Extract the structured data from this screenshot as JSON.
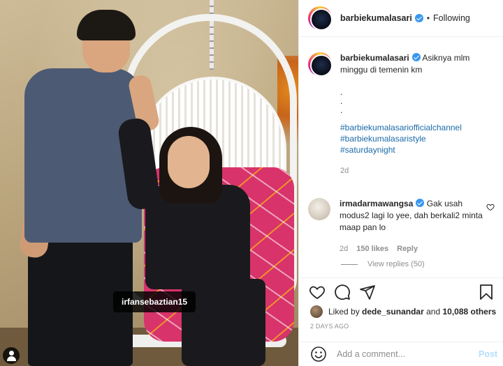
{
  "post": {
    "username": "barbiekumalasari",
    "follow_status": "Following",
    "separator": "•",
    "photo_tag": "irfansebaztian15"
  },
  "caption": {
    "username": "barbiekumalasari",
    "text": "Asiknya mlm minggu di temenin km",
    "dots": [
      ".",
      ".",
      "."
    ],
    "hashtags": [
      "#barbiekumalasariofficialchannel",
      "#barbiekumalasaristyle",
      "#saturdaynight"
    ],
    "time": "2d"
  },
  "comment": {
    "username": "irmadarmawangsa",
    "text": "Gak usah modus2 lagi lo yee, dah berkali2 minta maap pan lo",
    "time": "2d",
    "likes": "150 likes",
    "reply_label": "Reply"
  },
  "view_replies": "View replies (50)",
  "likes_line": {
    "prefix": "Liked by",
    "user": "dede_sunandar",
    "middle": "and",
    "others": "10,088 others"
  },
  "post_time": "2 DAYS AGO",
  "add_comment": {
    "placeholder": "Add a comment...",
    "post_label": "Post"
  },
  "icons": {
    "verified": "verified-badge-icon",
    "heart": "heart-icon",
    "comment": "comment-icon",
    "share": "paper-plane-icon",
    "save": "bookmark-icon",
    "emoji": "smiley-icon",
    "user_tag": "user-tag-icon"
  },
  "colors": {
    "link": "#1b6aa8",
    "verified": "#3897f0",
    "muted": "#8e8e8e",
    "post_button": "#b2dffc"
  }
}
